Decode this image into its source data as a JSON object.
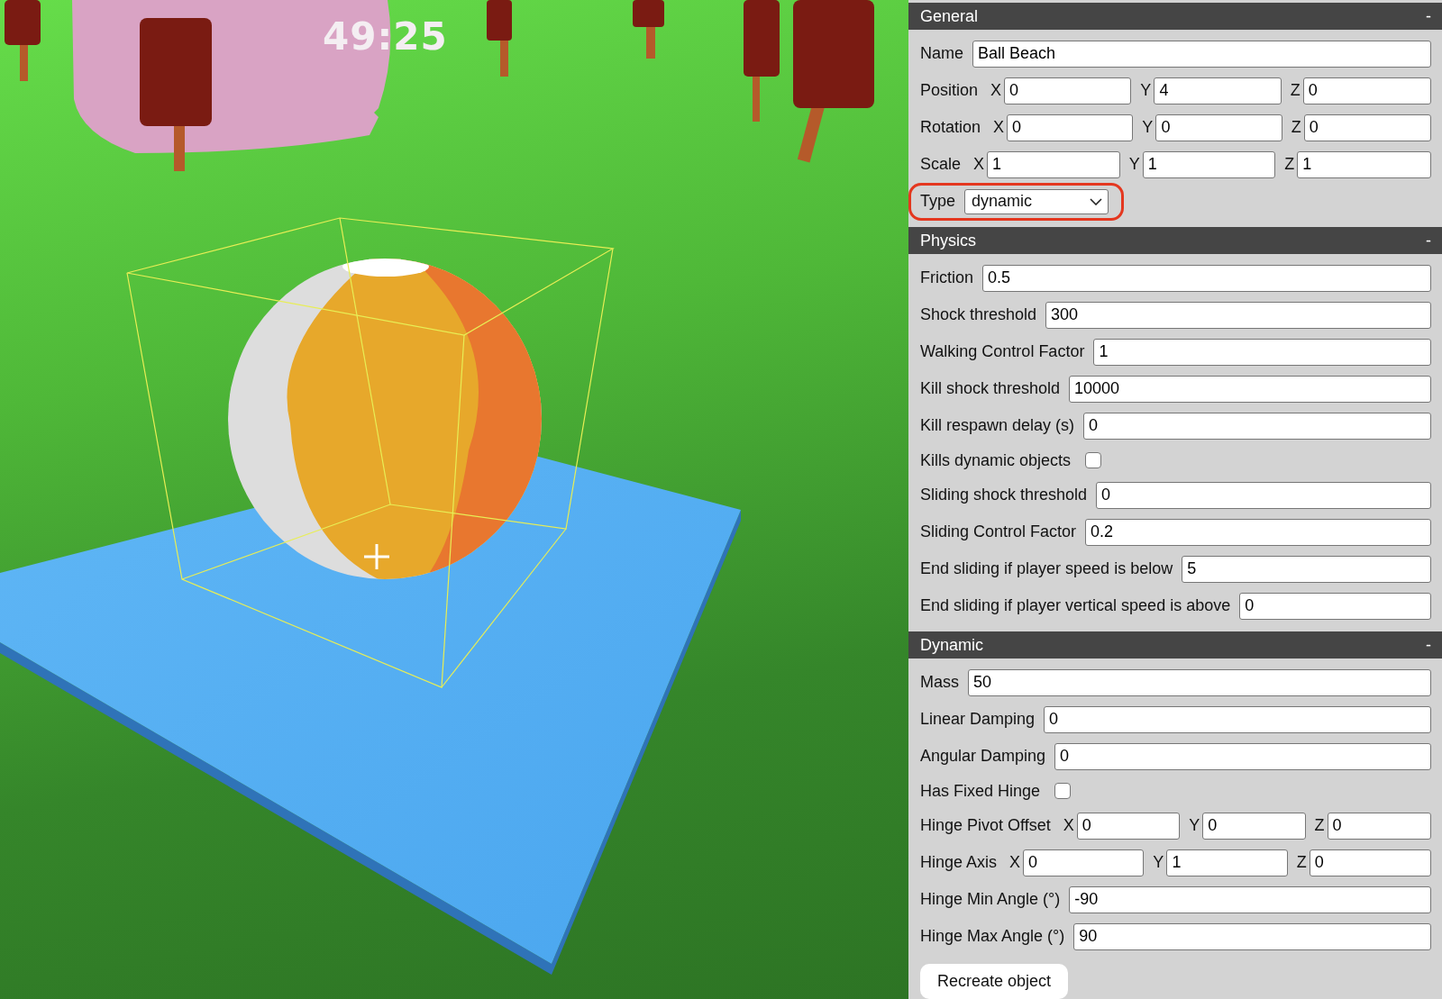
{
  "viewport": {
    "timer": "49:25"
  },
  "sections": [
    {
      "title": "General",
      "collapse": "-",
      "rows": [
        {
          "kind": "text",
          "label": "Name",
          "value": "Ball Beach"
        },
        {
          "kind": "vector",
          "label": "Position",
          "fields": [
            {
              "axis": "X",
              "value": "0"
            },
            {
              "axis": "Y",
              "value": "4"
            },
            {
              "axis": "Z",
              "value": "0"
            }
          ]
        },
        {
          "kind": "vector",
          "label": "Rotation",
          "fields": [
            {
              "axis": "X",
              "value": "0"
            },
            {
              "axis": "Y",
              "value": "0"
            },
            {
              "axis": "Z",
              "value": "0"
            }
          ]
        },
        {
          "kind": "vector",
          "label": "Scale",
          "fields": [
            {
              "axis": "X",
              "value": "1"
            },
            {
              "axis": "Y",
              "value": "1"
            },
            {
              "axis": "Z",
              "value": "1"
            }
          ]
        },
        {
          "kind": "select",
          "label": "Type",
          "value": "dynamic",
          "highlighted": true
        }
      ]
    },
    {
      "title": "Physics",
      "collapse": "-",
      "rows": [
        {
          "kind": "text",
          "label": "Friction",
          "value": "0.5"
        },
        {
          "kind": "text",
          "label": "Shock threshold",
          "value": "300"
        },
        {
          "kind": "text",
          "label": "Walking Control Factor",
          "value": "1"
        },
        {
          "kind": "text",
          "label": "Kill shock threshold",
          "value": "10000"
        },
        {
          "kind": "text",
          "label": "Kill respawn delay (s)",
          "value": "0"
        },
        {
          "kind": "checkbox",
          "label": "Kills dynamic objects",
          "checked": false
        },
        {
          "kind": "text",
          "label": "Sliding shock threshold",
          "value": "0"
        },
        {
          "kind": "text",
          "label": "Sliding Control Factor",
          "value": "0.2"
        },
        {
          "kind": "text",
          "label": "End sliding if player speed is below",
          "value": "5"
        },
        {
          "kind": "text",
          "label": "End sliding if player vertical speed is above",
          "value": "0"
        }
      ]
    },
    {
      "title": "Dynamic",
      "collapse": "-",
      "rows": [
        {
          "kind": "text",
          "label": "Mass",
          "value": "50"
        },
        {
          "kind": "text",
          "label": "Linear Damping",
          "value": "0"
        },
        {
          "kind": "text",
          "label": "Angular Damping",
          "value": "0"
        },
        {
          "kind": "checkbox",
          "label": "Has Fixed Hinge",
          "checked": false
        },
        {
          "kind": "vector",
          "label": "Hinge Pivot Offset",
          "fields": [
            {
              "axis": "X",
              "value": "0"
            },
            {
              "axis": "Y",
              "value": "0"
            },
            {
              "axis": "Z",
              "value": "0"
            }
          ]
        },
        {
          "kind": "vector",
          "label": "Hinge Axis",
          "fields": [
            {
              "axis": "X",
              "value": "0"
            },
            {
              "axis": "Y",
              "value": "1"
            },
            {
              "axis": "Z",
              "value": "0"
            }
          ]
        },
        {
          "kind": "text",
          "label": "Hinge Min Angle (°)",
          "value": "-90"
        },
        {
          "kind": "text",
          "label": "Hinge Max Angle (°)",
          "value": "90"
        }
      ]
    }
  ],
  "button": "Recreate object"
}
